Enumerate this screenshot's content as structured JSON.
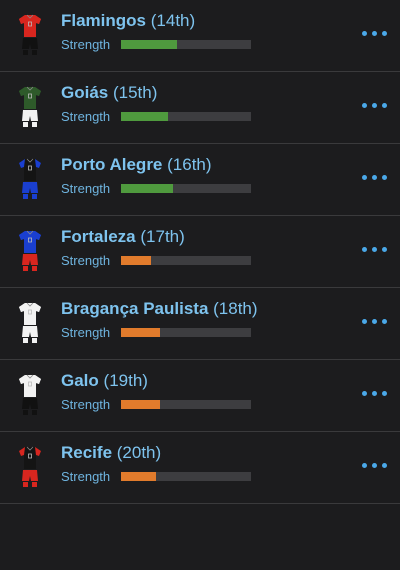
{
  "strength_label": "Strength",
  "colors": {
    "strong": "#4f9a3e",
    "weak": "#e17b2c"
  },
  "teams": [
    {
      "name": "Flamingos",
      "rank": "(14th)",
      "strength": 0.43,
      "level": "strong",
      "shirt": "#d8261f",
      "sleeve": "#d8261f",
      "shorts": "#111111"
    },
    {
      "name": "Goiás",
      "rank": "(15th)",
      "strength": 0.36,
      "level": "strong",
      "shirt": "#2e5a2a",
      "sleeve": "#2e5a2a",
      "shorts": "#f2f2f2"
    },
    {
      "name": "Porto Alegre",
      "rank": "(16th)",
      "strength": 0.4,
      "level": "strong",
      "shirt": "#141414",
      "sleeve": "#1a3fd0",
      "shorts": "#1a3fd0"
    },
    {
      "name": "Fortaleza",
      "rank": "(17th)",
      "strength": 0.23,
      "level": "weak",
      "shirt": "#1a3fd0",
      "sleeve": "#1a3fd0",
      "shorts": "#d8261f"
    },
    {
      "name": "Bragança Paulista",
      "rank": "(18th)",
      "strength": 0.3,
      "level": "weak",
      "shirt": "#f2f2f2",
      "sleeve": "#f2f2f2",
      "shorts": "#f2f2f2"
    },
    {
      "name": "Galo",
      "rank": "(19th)",
      "strength": 0.3,
      "level": "weak",
      "shirt": "#f2f2f2",
      "sleeve": "#f2f2f2",
      "shorts": "#111111"
    },
    {
      "name": "Recife",
      "rank": "(20th)",
      "strength": 0.27,
      "level": "weak",
      "shirt": "#141414",
      "sleeve": "#d8261f",
      "shorts": "#d8261f"
    }
  ]
}
